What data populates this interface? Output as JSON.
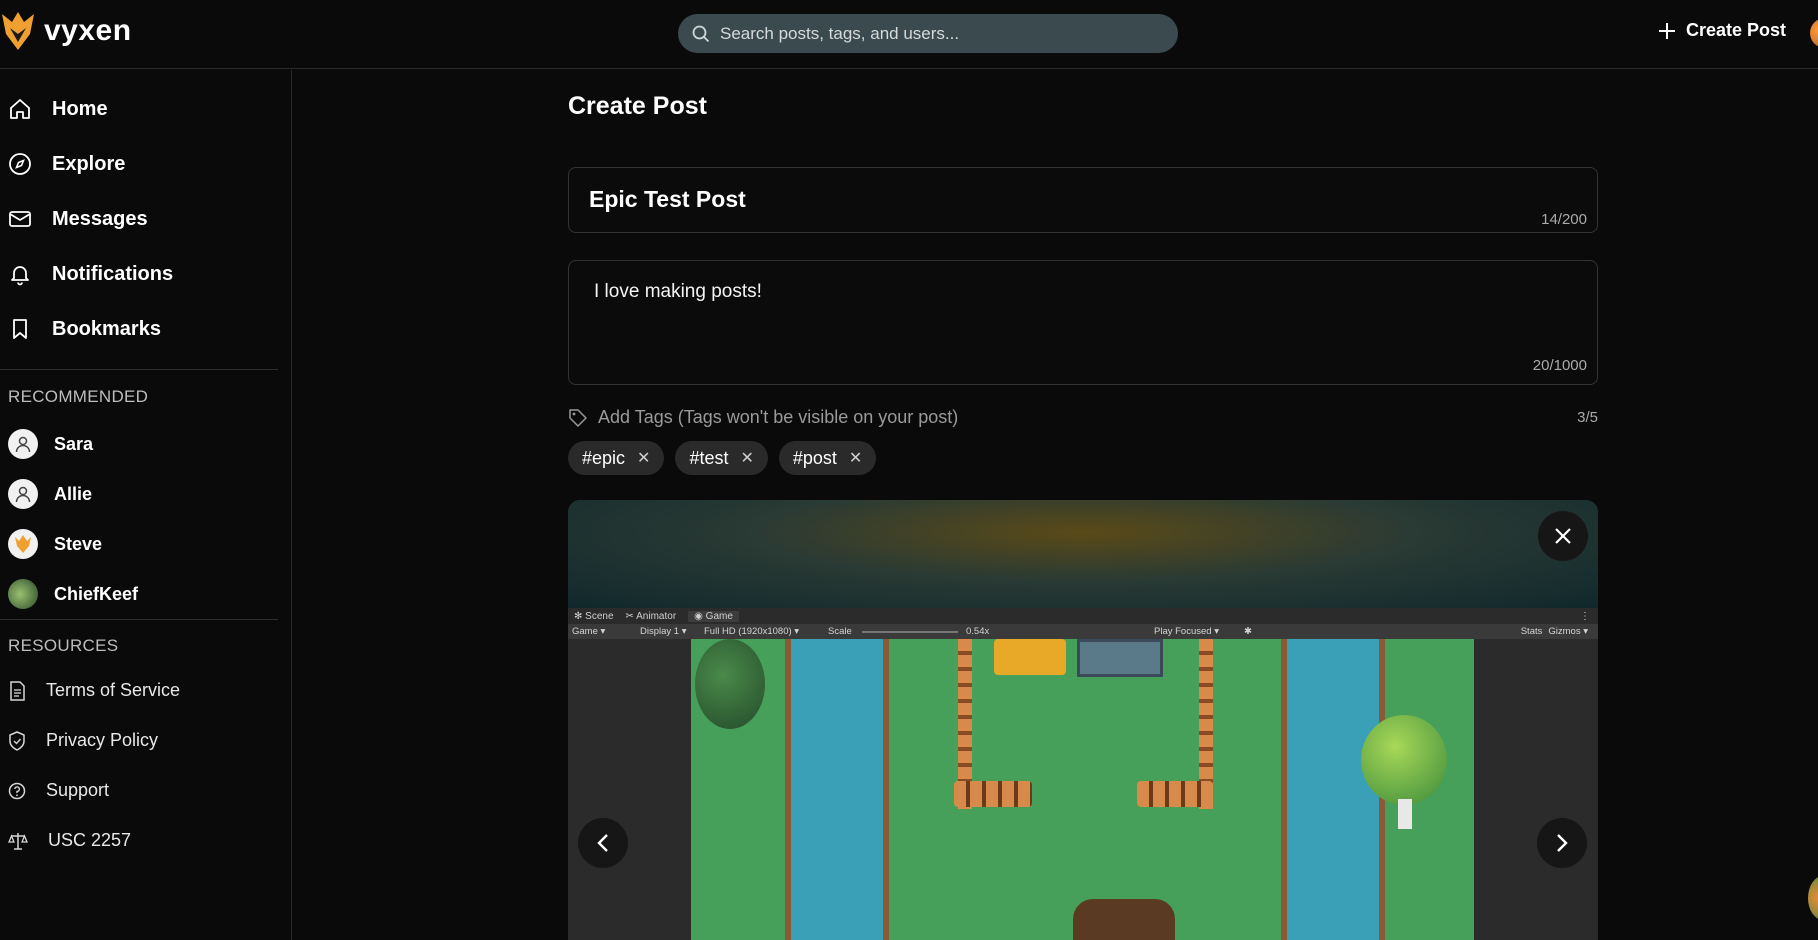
{
  "app": {
    "brand": "vyxen"
  },
  "header": {
    "search_placeholder": "Search posts, tags, and users...",
    "create_post_label": "Create Post"
  },
  "sidebar": {
    "nav": [
      {
        "label": "Home",
        "icon": "home-icon"
      },
      {
        "label": "Explore",
        "icon": "compass-icon"
      },
      {
        "label": "Messages",
        "icon": "mail-icon"
      },
      {
        "label": "Notifications",
        "icon": "bell-icon"
      },
      {
        "label": "Bookmarks",
        "icon": "bookmark-icon"
      }
    ],
    "recommended_title": "RECOMMENDED",
    "recommended": [
      {
        "name": "Sara"
      },
      {
        "name": "Allie"
      },
      {
        "name": "Steve"
      },
      {
        "name": "ChiefKeef"
      }
    ],
    "resources_title": "RESOURCES",
    "resources": [
      {
        "label": "Terms of Service",
        "icon": "document-icon"
      },
      {
        "label": "Privacy Policy",
        "icon": "shield-icon"
      },
      {
        "label": "Support",
        "icon": "help-circle-icon"
      },
      {
        "label": "USC 2257",
        "icon": "scale-icon"
      }
    ]
  },
  "main": {
    "title": "Create Post",
    "post_title": {
      "value": "Epic Test Post",
      "counter": "14/200"
    },
    "post_body": {
      "value": "I love making posts!",
      "counter": "20/1000"
    },
    "tags": {
      "placeholder": "Add Tags (Tags won't be visible on your post)",
      "counter": "3/5",
      "items": [
        "#epic",
        "#test",
        "#post"
      ]
    },
    "media": {
      "unity_tabs": [
        "Scene",
        "Animator",
        "Game"
      ],
      "unity_toolbar": {
        "view": "Game",
        "display": "Display 1",
        "resolution": "Full HD (1920x1080)",
        "scale_label": "Scale",
        "scale_value": "0.54x",
        "play_mode": "Play Focused",
        "stats": "Stats",
        "gizmos": "Gizmos"
      }
    }
  },
  "colors": {
    "background": "#0a0a0a",
    "search_bg": "#3a4a4e",
    "chip_bg": "#2a2a2a",
    "grass": "#46a05a",
    "water": "#3aa0b8"
  }
}
